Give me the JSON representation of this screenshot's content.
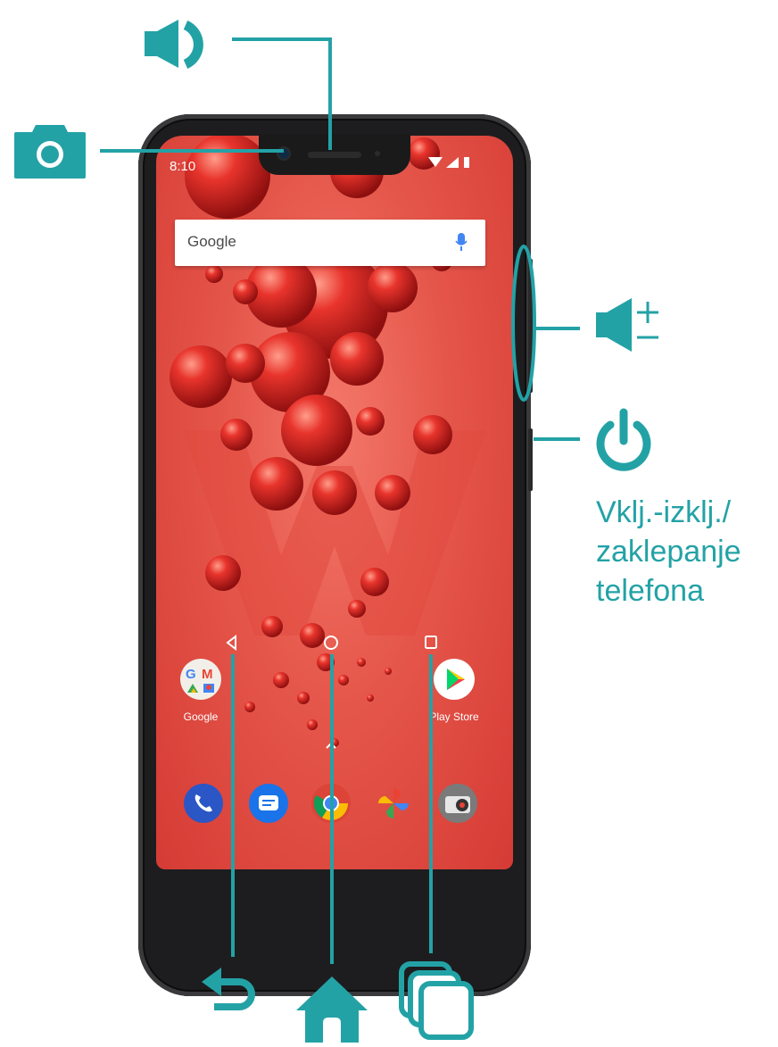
{
  "colors": {
    "accent": "#23a2a6",
    "phone_body": "#1d1d1f",
    "screen_red": "#e5564a"
  },
  "status_bar": {
    "time": "8:10"
  },
  "search_widget": {
    "logo_text": "Google",
    "icon": "mic-icon"
  },
  "home_apps": [
    {
      "label": "Google",
      "icon": "google-folder-icon"
    },
    {
      "label": "Play Store",
      "icon": "play-store-icon"
    }
  ],
  "dock_apps": [
    {
      "icon": "phone-icon"
    },
    {
      "icon": "messages-icon"
    },
    {
      "icon": "chrome-icon"
    },
    {
      "icon": "photos-icon"
    },
    {
      "icon": "camera-icon"
    }
  ],
  "callouts": {
    "speaker": {
      "icon": "speaker-icon"
    },
    "front_camera": {
      "icon": "camera-icon"
    },
    "volume": {
      "icon": "volume-plus-minus-icon"
    },
    "power": {
      "icon": "power-icon",
      "label_lines": [
        "Vklj.-izklj./",
        "zaklepanje",
        "telefona"
      ]
    },
    "back": {
      "icon": "back-arrow-icon"
    },
    "home": {
      "icon": "home-icon"
    },
    "recent_apps": {
      "icon": "recent-apps-icon"
    }
  }
}
